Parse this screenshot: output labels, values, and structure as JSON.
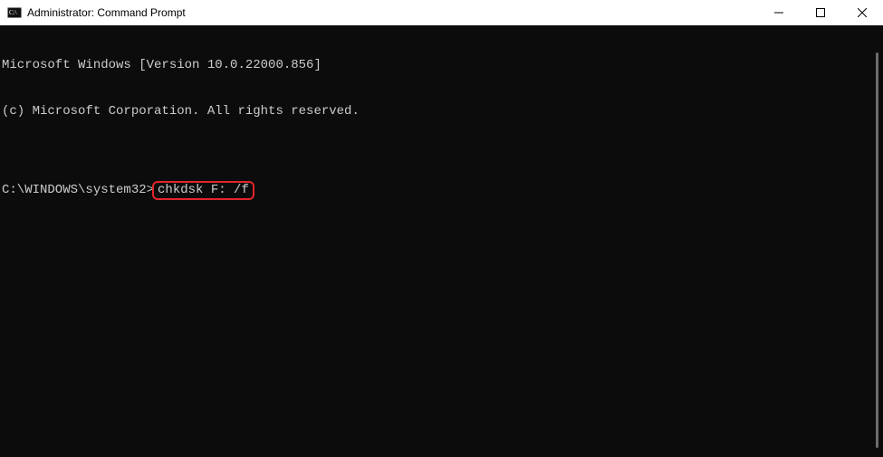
{
  "titlebar": {
    "title": "Administrator: Command Prompt"
  },
  "terminal": {
    "line1": "Microsoft Windows [Version 10.0.22000.856]",
    "line2": "(c) Microsoft Corporation. All rights reserved.",
    "blank": "",
    "prompt": "C:\\WINDOWS\\system32>",
    "command": "chkdsk F: /f"
  },
  "highlight": {
    "color": "#e3252a"
  }
}
